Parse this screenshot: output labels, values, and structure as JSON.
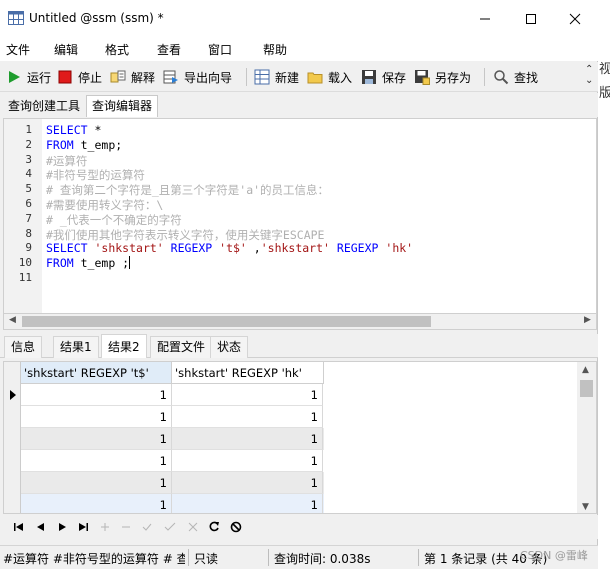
{
  "window": {
    "title": "Untitled @ssm (ssm) *"
  },
  "menu": [
    "文件",
    "编辑",
    "格式",
    "查看",
    "窗口",
    "帮助"
  ],
  "toolbar": {
    "run": "运行",
    "stop": "停止",
    "explain": "解释",
    "export_wizard": "导出向导",
    "new": "新建",
    "load": "载入",
    "save": "保存",
    "save_as": "另存为",
    "find": "查找"
  },
  "query_tabs": [
    "查询创建工具",
    "查询编辑器"
  ],
  "editor": {
    "line_numbers": [
      "1",
      "2",
      "3",
      "4",
      "5",
      "6",
      "7",
      "8",
      "9",
      "10",
      "11"
    ],
    "lines": [
      [
        {
          "t": "SELECT",
          "c": "kw"
        },
        {
          "t": " *",
          "c": "tx"
        }
      ],
      [
        {
          "t": "FROM",
          "c": "kw"
        },
        {
          "t": " t_emp;",
          "c": "tx"
        }
      ],
      [
        {
          "t": "#运算符",
          "c": "cm"
        }
      ],
      [
        {
          "t": "#非符号型的运算符",
          "c": "cm"
        }
      ],
      [
        {
          "t": "# 查询第二个字符是_且第三个字符是'a'的员工信息：",
          "c": "cm"
        }
      ],
      [
        {
          "t": "#需要使用转义字符：\\",
          "c": "cm"
        }
      ],
      [
        {
          "t": "# _代表一个不确定的字符",
          "c": "cm"
        }
      ],
      [
        {
          "t": "#我们使用其他字符表示转义字符，使用关键字ESCAPE",
          "c": "cm"
        }
      ],
      [
        {
          "t": "SELECT",
          "c": "kw"
        },
        {
          "t": " ",
          "c": "tx"
        },
        {
          "t": "'shkstart'",
          "c": "str"
        },
        {
          "t": " ",
          "c": "tx"
        },
        {
          "t": "REGEXP",
          "c": "kw"
        },
        {
          "t": " ",
          "c": "tx"
        },
        {
          "t": "'t$'",
          "c": "str"
        },
        {
          "t": " ,",
          "c": "tx"
        },
        {
          "t": "'shkstart'",
          "c": "str"
        },
        {
          "t": " ",
          "c": "tx"
        },
        {
          "t": "REGEXP",
          "c": "kw"
        },
        {
          "t": " ",
          "c": "tx"
        },
        {
          "t": "'hk'",
          "c": "str"
        }
      ],
      [
        {
          "t": "FROM",
          "c": "kw"
        },
        {
          "t": " t_emp ;",
          "c": "tx"
        }
      ],
      []
    ]
  },
  "result_tabs": [
    "信息",
    "结果1",
    "结果2",
    "配置文件",
    "状态"
  ],
  "grid": {
    "columns": [
      "'shkstart' REGEXP 't$'",
      "'shkstart' REGEXP 'hk'"
    ],
    "rows": [
      [
        "1",
        "1"
      ],
      [
        "1",
        "1"
      ],
      [
        "1",
        "1"
      ],
      [
        "1",
        "1"
      ],
      [
        "1",
        "1"
      ],
      [
        "1",
        "1"
      ]
    ]
  },
  "status": {
    "query_snippet": "#运算符 #非符号型的运算符 # 查",
    "mode": "只读",
    "query_time": "查询时间: 0.038s",
    "records": "第 1 条记录 (共 40 条)"
  },
  "watermark": "CSDN @雷峰",
  "outside_text": [
    "视",
    "版"
  ],
  "colors": {
    "keyword": "#0000ff",
    "string": "#a31515",
    "comment": "#b0b0b0"
  }
}
